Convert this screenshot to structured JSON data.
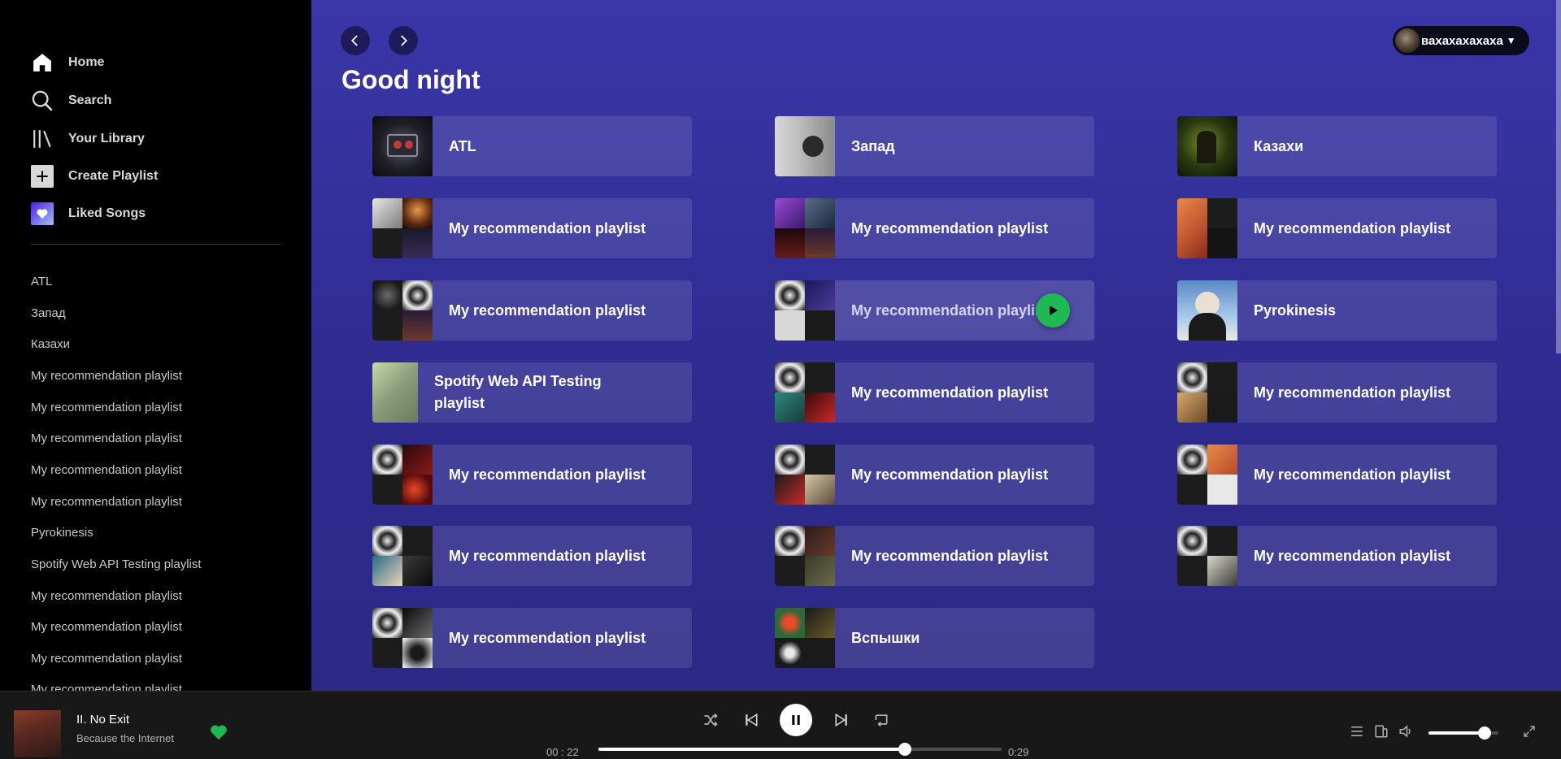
{
  "sidebar": {
    "nav": [
      {
        "label": "Home",
        "icon": "home-icon"
      },
      {
        "label": "Search",
        "icon": "search-icon"
      },
      {
        "label": "Your Library",
        "icon": "library-icon"
      },
      {
        "label": "Create Playlist",
        "icon": "plus-icon"
      },
      {
        "label": "Liked Songs",
        "icon": "heart-icon"
      }
    ],
    "playlists": [
      "ATL",
      "Запад",
      "Казахи",
      "My recommendation playlist",
      "My recommendation playlist",
      "My recommendation playlist",
      "My recommendation playlist",
      "My recommendation playlist",
      "Pyrokinesis",
      "Spotify Web API Testing playlist",
      "My recommendation playlist",
      "My recommendation playlist",
      "My recommendation playlist",
      "My recommendation playlist"
    ]
  },
  "main": {
    "greeting": "Good night",
    "user": {
      "name": "вахахахахаха"
    },
    "cards": [
      {
        "title": "ATL"
      },
      {
        "title": "Запад"
      },
      {
        "title": "Казахи"
      },
      {
        "title": "My recommendation playlist"
      },
      {
        "title": "My recommendation playlist"
      },
      {
        "title": "My recommendation playlist"
      },
      {
        "title": "My recommendation playlist"
      },
      {
        "title": "My recommendation playlist"
      },
      {
        "title": "Pyrokinesis"
      },
      {
        "title": "Spotify Web API Testing playlist"
      },
      {
        "title": "My recommendation playlist"
      },
      {
        "title": "My recommendation playlist"
      },
      {
        "title": "My recommendation playlist"
      },
      {
        "title": "My recommendation playlist"
      },
      {
        "title": "My recommendation playlist"
      },
      {
        "title": "My recommendation playlist"
      },
      {
        "title": "My recommendation playlist"
      },
      {
        "title": "My recommendation playlist"
      },
      {
        "title": "My recommendation playlist"
      },
      {
        "title": "Вспышки"
      }
    ]
  },
  "player": {
    "track": "II. No Exit",
    "artist": "Because the Internet",
    "time_current": "00 : 22",
    "time_total": "0:29",
    "progress": 0.76,
    "volume": 0.8,
    "liked": true
  },
  "colors": {
    "accent": "#1fb954",
    "main_bg": "#2e2a8e",
    "sidebar_bg": "#000000",
    "player_bg": "#181818"
  }
}
